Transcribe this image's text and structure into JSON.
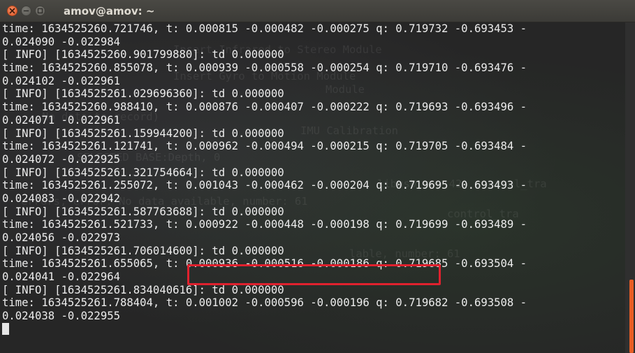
{
  "window": {
    "title": "amov@amov: ~"
  },
  "terminal": {
    "lines": [
      "time: 1634525260.721746, t: 0.000815 -0.000482 -0.000275 q: 0.719732 -0.693453 -",
      "0.024090 -0.022984",
      "[ INFO] [1634525260.901799880]: td 0.000000",
      "time: 1634525260.855078, t: 0.000939 -0.000558 -0.000254 q: 0.719710 -0.693476 -",
      "0.024102 -0.022961",
      "[ INFO] [1634525261.029696360]: td 0.000000",
      "time: 1634525260.988410, t: 0.000876 -0.000407 -0.000222 q: 0.719693 -0.693496 -",
      "0.024071 -0.022961",
      "[ INFO] [1634525261.159944200]: td 0.000000",
      "time: 1634525261.121741, t: 0.000962 -0.000494 -0.000215 q: 0.719705 -0.693484 -",
      "0.024072 -0.022925",
      "[ INFO] [1634525261.321754664]: td 0.000000",
      "time: 1634525261.255072, t: 0.001043 -0.000462 -0.000204 q: 0.719695 -0.693493 -",
      "0.024083 -0.022942",
      "[ INFO] [1634525261.587763688]: td 0.000000",
      "time: 1634525261.521733, t: 0.000922 -0.000448 -0.000198 q: 0.719699 -0.693489 -",
      "0.024056 -0.022973",
      "[ INFO] [1634525261.706014600]: td 0.000000",
      "time: 1634525261.655065, t: 0.000936 -0.000516 -0.000186 q: 0.719685 -0.693504 -",
      "0.024041 -0.022964",
      "[ INFO] [1634525261.834040616]: td 0.000000",
      "time: 1634525261.788404, t: 0.001002 -0.000596 -0.000196 q: 0.719682 -0.693508 -",
      "0.024038 -0.022955"
    ],
    "ghost_lines": [
      "Insert Infrared to Stereo Module",
      "Insert Gyro to Motion Module",
      "Module",
      "No data to record)",
      "IMU Calibration",
      "SELECTED BASE:Depth, 0",
      "libusb.cpp:42) control_tra",
      "errors, error: No data available, number: 61",
      "control_tra",
      "lable, number: 61"
    ]
  },
  "colors": {
    "highlight": "#e0212e",
    "scroll_thumb": "#e85e25",
    "close_button": "#e05a2a"
  },
  "icons": [
    "close-icon",
    "minimize-icon",
    "maximize-icon"
  ]
}
